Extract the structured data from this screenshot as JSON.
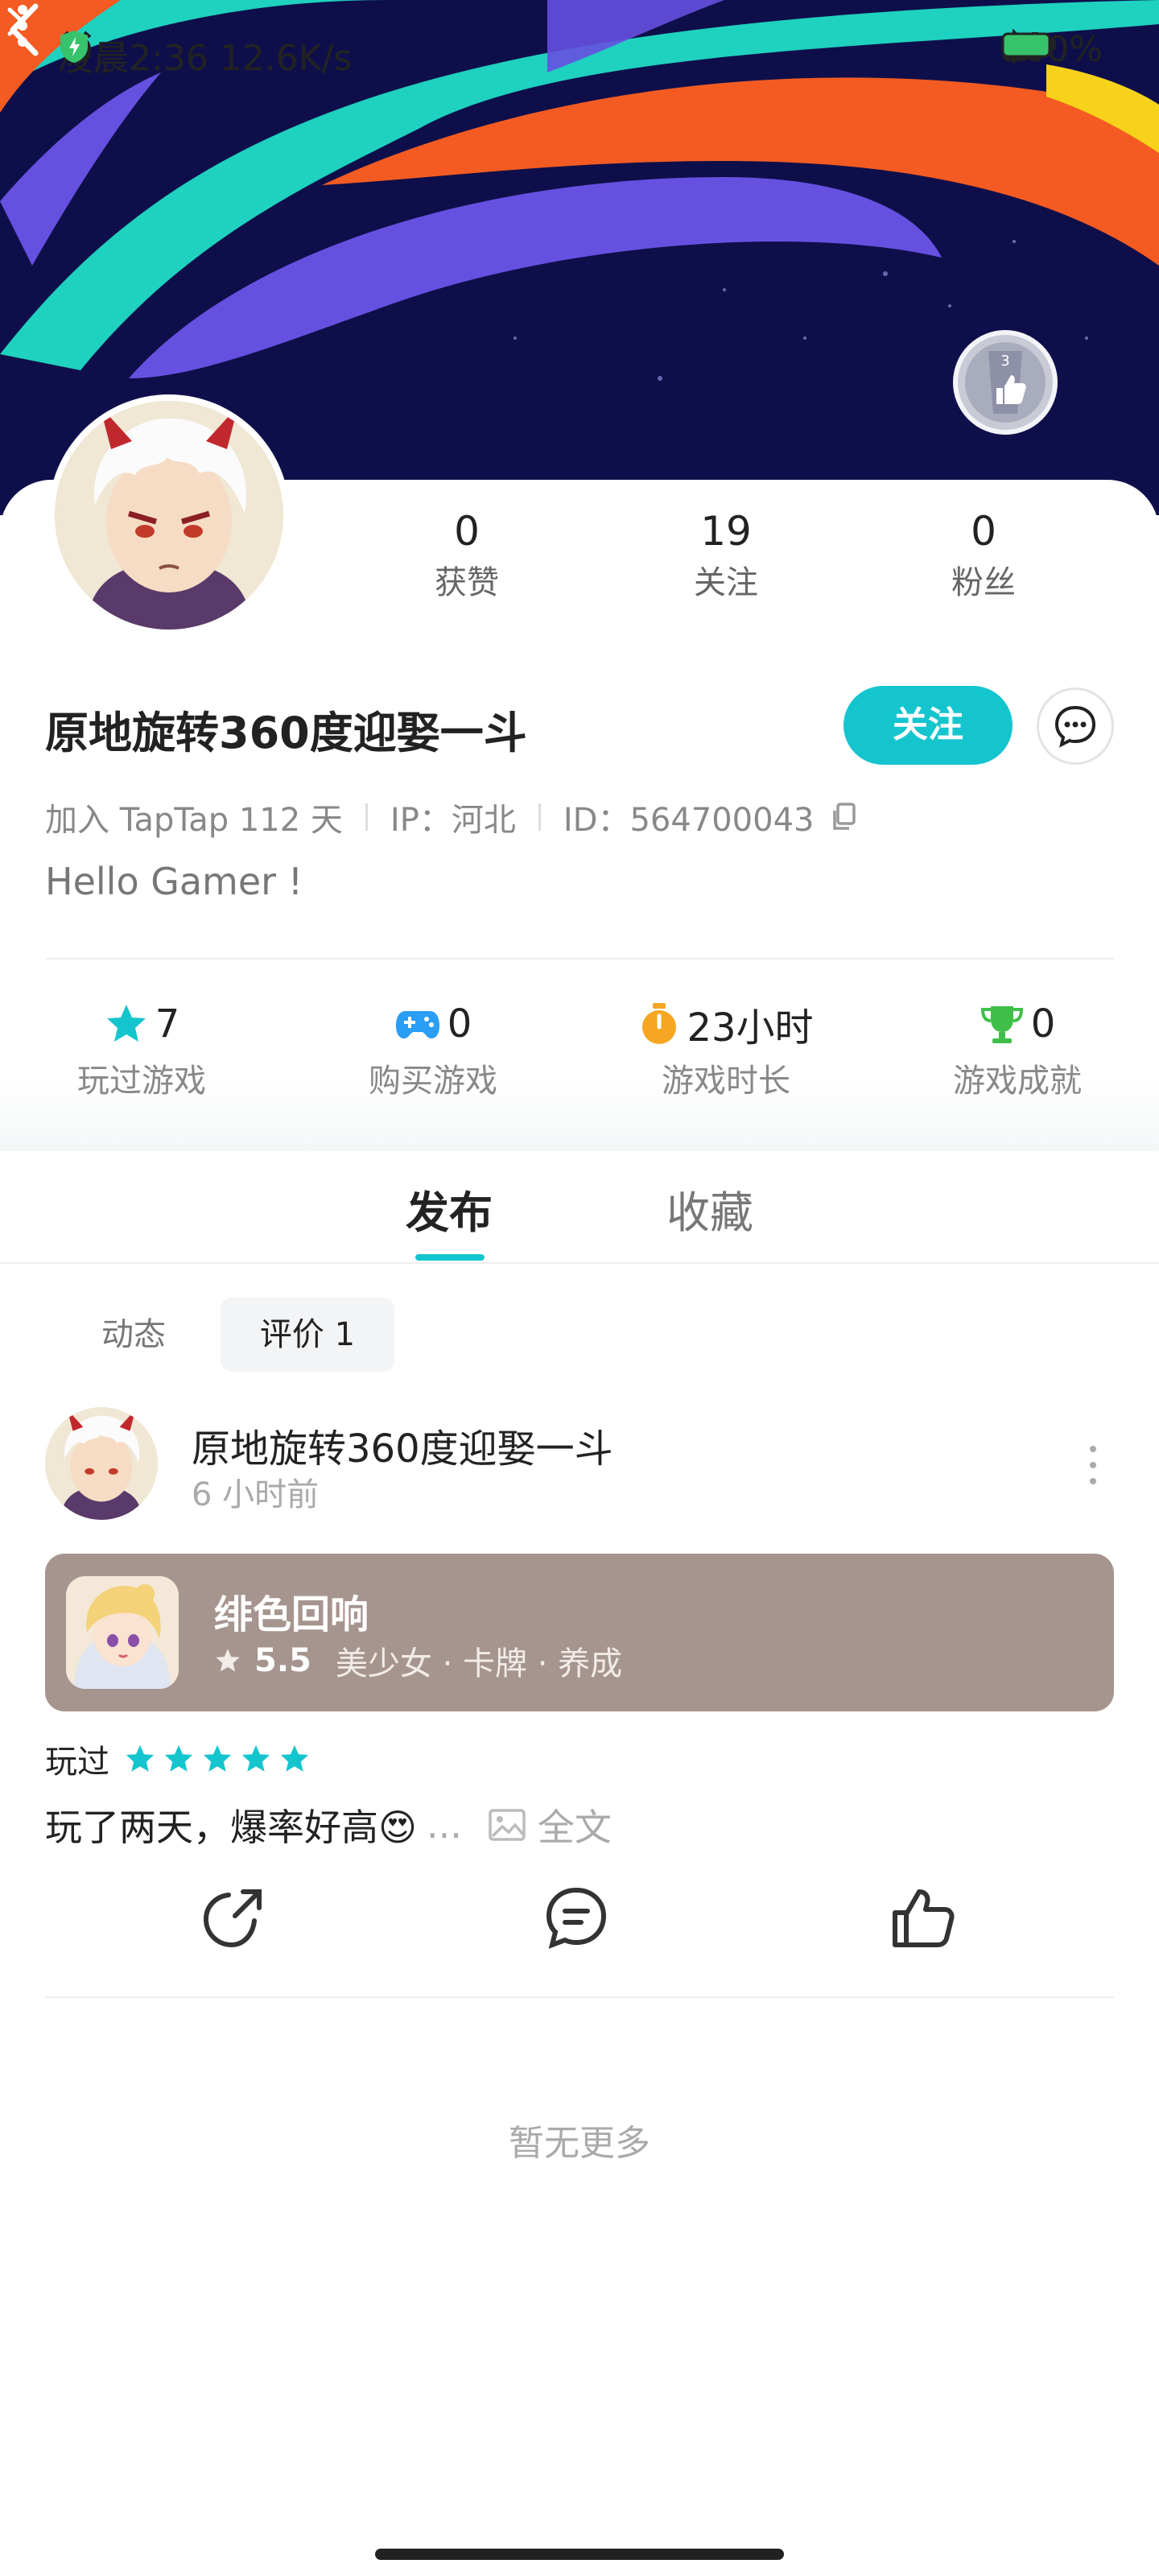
{
  "status_bar": {
    "text": "凌晨2:36 12.6K/s",
    "battery": "100%"
  },
  "profile": {
    "stats": [
      {
        "value": "0",
        "label": "获赞"
      },
      {
        "value": "19",
        "label": "关注"
      },
      {
        "value": "0",
        "label": "粉丝"
      }
    ],
    "username": "原地旋转360度迎娶一斗",
    "follow_label": "关注",
    "meta": {
      "joined": "加入 TapTap 112 天",
      "ip": "IP：河北",
      "id": "ID：564700043"
    },
    "bio": "Hello Gamer !",
    "badge_number": "3"
  },
  "game_stats": [
    {
      "value": "7",
      "label": "玩过游戏",
      "icon": "star-icon",
      "color": "#15c5ce"
    },
    {
      "value": "0",
      "label": "购买游戏",
      "icon": "gamepad-icon",
      "color": "#2a9df4"
    },
    {
      "value": "23小时",
      "label": "游戏时长",
      "icon": "stopwatch-icon",
      "color": "#f5a623"
    },
    {
      "value": "0",
      "label": "游戏成就",
      "icon": "trophy-icon",
      "color": "#3fbf4a"
    }
  ],
  "tabs": [
    {
      "label": "发布",
      "active": true
    },
    {
      "label": "收藏",
      "active": false
    }
  ],
  "filters": [
    {
      "label": "动态",
      "selected": false
    },
    {
      "label": "评价 1",
      "selected": true
    }
  ],
  "post": {
    "author": "原地旋转360度迎娶一斗",
    "time": "6 小时前",
    "game": {
      "name": "绯色回响",
      "score": "5.5",
      "tags": "美少女 · 卡牌 · 养成"
    },
    "played_label": "玩过",
    "stars": 5,
    "review_text": "玩了两天，爆率好高😍",
    "ellipsis": "...",
    "full_text_label": "全文"
  },
  "footer_text": "暂无更多",
  "colors": {
    "accent": "#15c5ce",
    "banner_bg": "#0e0f4a",
    "game_card_bg": "#a6958f"
  }
}
